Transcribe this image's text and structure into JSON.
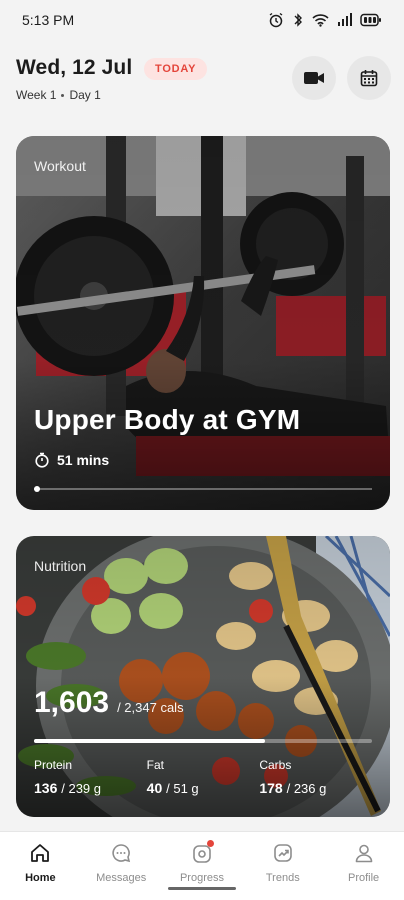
{
  "status_bar": {
    "time": "5:13 PM",
    "icons": [
      "alarm-icon",
      "bluetooth-icon",
      "wifi-icon",
      "signal-icon",
      "battery-icon"
    ]
  },
  "header": {
    "date": "Wed, 12 Jul",
    "today_badge": "TODAY",
    "week": "Week 1",
    "day": "Day 1",
    "video_button_icon": "video-camera-icon",
    "calendar_button_icon": "calendar-icon"
  },
  "workout_card": {
    "label": "Workout",
    "title": "Upper Body at GYM",
    "duration": "51 mins",
    "carousel_position": 0
  },
  "nutrition_card": {
    "label": "Nutrition",
    "calories_eaten": "1,603",
    "calories_total": "/ 2,347 cals",
    "calorie_progress": 0.683,
    "macros": [
      {
        "label": "Protein",
        "value": "136",
        "total": "/ 239 g"
      },
      {
        "label": "Fat",
        "value": "40",
        "total": "/ 51 g"
      },
      {
        "label": "Carbs",
        "value": "178",
        "total": "/ 236 g"
      }
    ]
  },
  "tabbar": {
    "tabs": [
      {
        "label": "Home",
        "icon": "home-icon",
        "active": true
      },
      {
        "label": "Messages",
        "icon": "chat-icon",
        "active": false
      },
      {
        "label": "Progress",
        "icon": "progress-icon",
        "active": false,
        "notification": true
      },
      {
        "label": "Trends",
        "icon": "trends-icon",
        "active": false
      },
      {
        "label": "Profile",
        "icon": "profile-icon",
        "active": false
      }
    ]
  },
  "colors": {
    "accent": "#e4453b",
    "badge_bg": "#fde3e1",
    "background": "#f3f3f3"
  }
}
